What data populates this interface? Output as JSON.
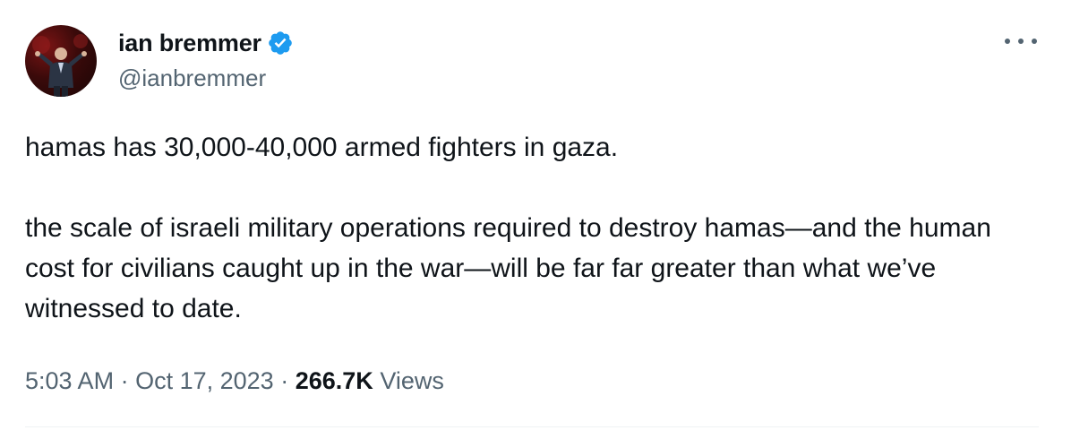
{
  "author": {
    "display_name": "ian bremmer",
    "handle": "@ianbremmer",
    "verified": true,
    "verified_color": "#1d9bf0"
  },
  "tweet": {
    "paragraphs": [
      "hamas has 30,000-40,000 armed fighters in gaza.",
      "the scale of israeli military operations required to destroy hamas—and the human cost for civilians caught up in the war—will be far far greater than what we’ve witnessed to date."
    ]
  },
  "meta": {
    "time": "5:03 AM",
    "separator": "·",
    "date": "Oct 17, 2023",
    "views_count": "266.7K",
    "views_label": "Views"
  },
  "icons": {
    "more": "more-options-icon",
    "verified": "verified-badge-icon"
  }
}
